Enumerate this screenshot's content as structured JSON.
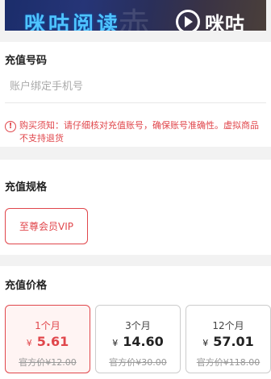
{
  "banner": {
    "text": "咪咕阅读",
    "brand": "咪咕"
  },
  "recharge_number": {
    "title": "充值号码",
    "input_value": "",
    "input_placeholder": "账户绑定手机号",
    "notice": "购买须知：请仔细核对充值账号，确保账号准确性。虚拟商品不支持退货"
  },
  "recharge_spec": {
    "title": "充值规格",
    "options": [
      {
        "label": "至尊会员VIP",
        "selected": true
      }
    ]
  },
  "recharge_price": {
    "title": "充值价格",
    "currency": "¥",
    "options": [
      {
        "period": "1个月",
        "price": "5.61",
        "original": "官方价¥12.00",
        "selected": true
      },
      {
        "period": "3个月",
        "price": "14.60",
        "original": "官方价¥30.00",
        "selected": false
      },
      {
        "period": "12个月",
        "price": "57.01",
        "original": "官方价¥118.00",
        "selected": false
      }
    ]
  },
  "colors": {
    "accent": "#e0464b",
    "background": "#f2f2f2"
  }
}
